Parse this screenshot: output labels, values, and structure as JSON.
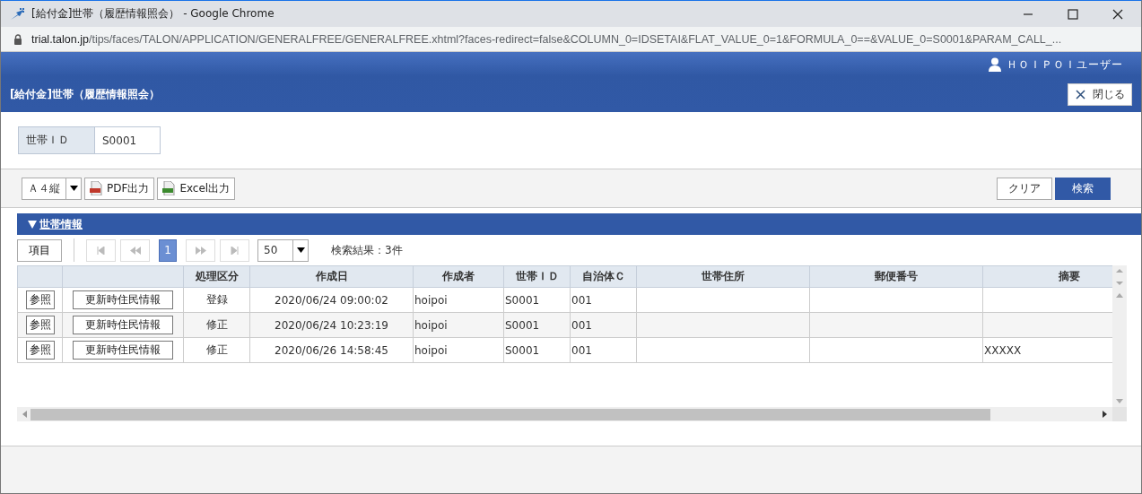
{
  "window": {
    "title": "[給付金]世帯（履歴情報照会） - Google Chrome"
  },
  "address_bar": {
    "host": "trial.talon.jp",
    "path": "/tips/faces/TALON/APPLICATION/GENERALFREE/GENERALFREE.xhtml?faces-redirect=false&COLUMN_0=IDSETAI&FLAT_VALUE_0=1&FORMULA_0==&VALUE_0=S0001&PARAM_CALL_..."
  },
  "header": {
    "user": "ＨＯＩＰＯＩユーザー",
    "page_title": "[給付金]世帯（履歴情報照会）",
    "close_button": "閉じる"
  },
  "search_fields": [
    {
      "label": "世帯ＩＤ",
      "value": "S0001"
    }
  ],
  "toolbar": {
    "paper_size": "Ａ４縦",
    "export_buttons": [
      {
        "label": "PDF出力",
        "kind": "pdf"
      },
      {
        "label": "Excel出力",
        "kind": "excel"
      }
    ],
    "clear_button": "クリア",
    "search_button": "検索"
  },
  "section": {
    "title": "世帯情報",
    "expanded": true
  },
  "pager": {
    "columns_button": "項目",
    "pages": [
      {
        "label": "1",
        "selected": true
      }
    ],
    "page_size": "50",
    "result": "検索結果：3件"
  },
  "table": {
    "columns": [
      "",
      "",
      "処理区分",
      "作成日",
      "作成者",
      "世帯ＩＤ",
      "自治体Ｃ",
      "世帯住所",
      "郵便番号",
      "摘要"
    ],
    "rows": [
      {
        "cells": [
          {
            "kind": "button",
            "text": "参照"
          },
          {
            "kind": "button",
            "text": "更新時住民情報"
          },
          {
            "kind": "text",
            "text": "登録"
          },
          {
            "kind": "text",
            "text": "2020/06/24 09:00:02"
          },
          {
            "kind": "text",
            "text": "hoipoi"
          },
          {
            "kind": "text",
            "text": "S0001"
          },
          {
            "kind": "text",
            "text": "001"
          },
          {
            "kind": "text",
            "text": ""
          },
          {
            "kind": "text",
            "text": ""
          },
          {
            "kind": "text",
            "text": ""
          }
        ]
      },
      {
        "cells": [
          {
            "kind": "button",
            "text": "参照"
          },
          {
            "kind": "button",
            "text": "更新時住民情報"
          },
          {
            "kind": "text",
            "text": "修正"
          },
          {
            "kind": "text",
            "text": "2020/06/24 10:23:19"
          },
          {
            "kind": "text",
            "text": "hoipoi"
          },
          {
            "kind": "text",
            "text": "S0001"
          },
          {
            "kind": "text",
            "text": "001"
          },
          {
            "kind": "text",
            "text": ""
          },
          {
            "kind": "text",
            "text": ""
          },
          {
            "kind": "text",
            "text": ""
          }
        ]
      },
      {
        "cells": [
          {
            "kind": "button",
            "text": "参照"
          },
          {
            "kind": "button",
            "text": "更新時住民情報"
          },
          {
            "kind": "text",
            "text": "修正"
          },
          {
            "kind": "text",
            "text": "2020/06/26 14:58:45"
          },
          {
            "kind": "text",
            "text": "hoipoi"
          },
          {
            "kind": "text",
            "text": "S0001"
          },
          {
            "kind": "text",
            "text": "001"
          },
          {
            "kind": "text",
            "text": ""
          },
          {
            "kind": "text",
            "text": ""
          },
          {
            "kind": "text",
            "text": "XXXXX"
          }
        ]
      }
    ]
  }
}
